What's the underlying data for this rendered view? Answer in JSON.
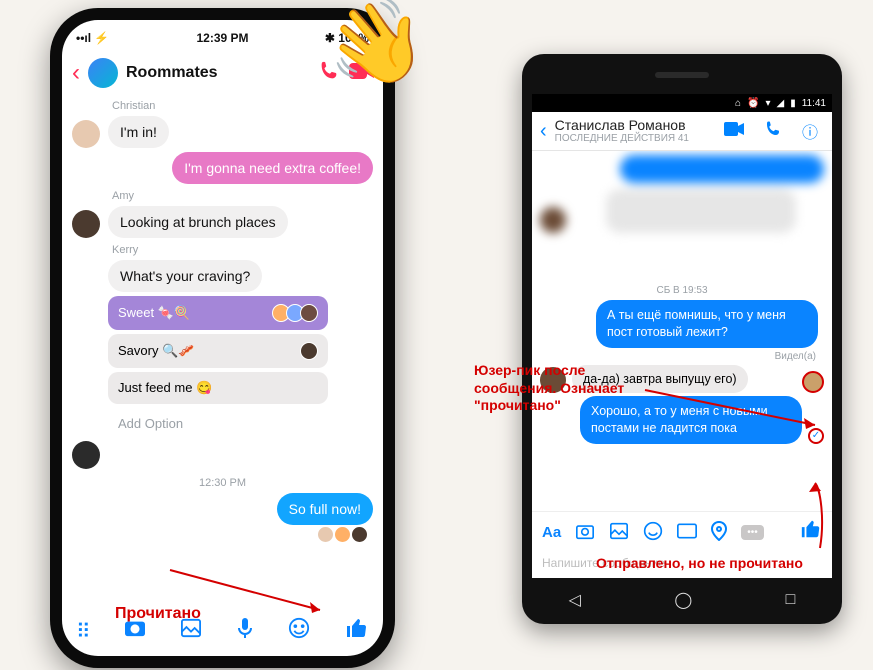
{
  "ios": {
    "status": {
      "signal": "••ıl ⚡",
      "time": "12:39 PM",
      "battery": "✱ 100%"
    },
    "header": {
      "title": "Roommates",
      "phone_icon": "phone",
      "video_icon": "video"
    },
    "messages": {
      "m1_sender": "Christian",
      "m1_text": "I'm in!",
      "m2_text": "I'm gonna need extra coffee!",
      "m3_sender": "Amy",
      "m3_text": "Looking at brunch places",
      "m4_sender": "Kerry",
      "m4_text": "What's your craving?"
    },
    "poll": {
      "opt1": "Sweet 🍬🍭",
      "opt2": "Savory 🔍🥓",
      "opt3": "Just feed me 😋",
      "add": "Add Option"
    },
    "timestamp": "12:30 PM",
    "m5_text": "So full now!",
    "toolbar": {
      "apps": "⠿",
      "camera": "📷",
      "photo": "🖼",
      "mic": "🎤",
      "emoji": "😊",
      "like": "👍"
    }
  },
  "android": {
    "status_time": "11:41",
    "header": {
      "name": "Станислав Романов",
      "sub": "ПОСЛЕДНИЕ ДЕЙСТВИЯ 41"
    },
    "timestamp": "СБ В 19:53",
    "m1": "А ты ещё помнишь, что у меня пост готовый лежит?",
    "seen": "Видел(а)",
    "m2": "да-да) завтра выпущу его)",
    "m3": "Хорошо, а то у меня с новыми постами не ладится пока",
    "composer": {
      "Aa": "Aa"
    },
    "placeholder": "Напишите сообщение"
  },
  "annotations": {
    "read": "Прочитано",
    "right1": "Юзер-пик после сообщения. Означает \"прочитано\"",
    "right2": "Отправлено, но не прочитано"
  }
}
